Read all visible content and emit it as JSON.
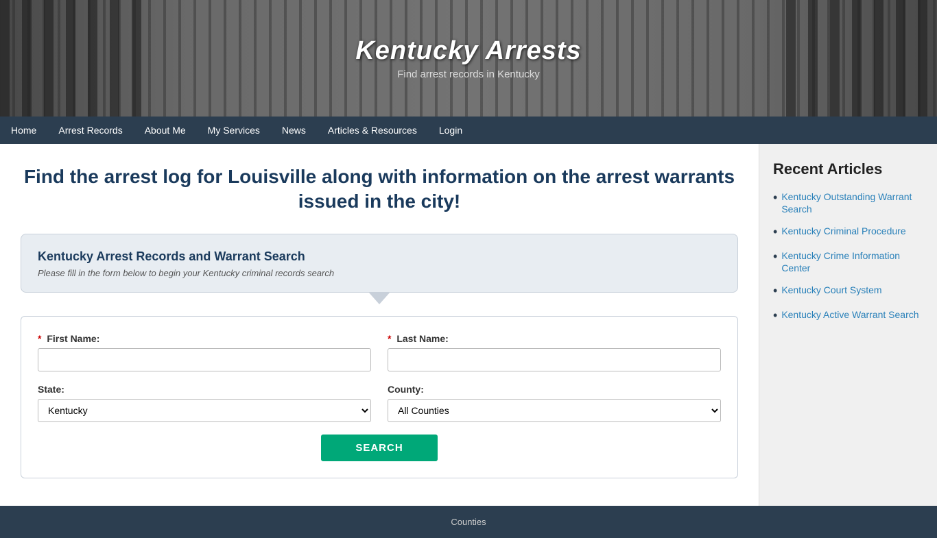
{
  "header": {
    "title": "Kentucky Arrests",
    "subtitle": "Find arrest records in Kentucky"
  },
  "nav": {
    "items": [
      {
        "label": "Home",
        "active": false
      },
      {
        "label": "Arrest Records",
        "active": false
      },
      {
        "label": "About Me",
        "active": false
      },
      {
        "label": "My Services",
        "active": false
      },
      {
        "label": "News",
        "active": false
      },
      {
        "label": "Articles & Resources",
        "active": false
      },
      {
        "label": "Login",
        "active": false
      }
    ]
  },
  "main": {
    "heading": "Find the arrest log for Louisville along with information on the arrest warrants issued in the city!",
    "search_box": {
      "title": "Kentucky Arrest Records and Warrant Search",
      "subtitle": "Please fill in the form below to begin your Kentucky criminal records search"
    },
    "form": {
      "first_name_label": "First Name:",
      "last_name_label": "Last Name:",
      "state_label": "State:",
      "county_label": "County:",
      "state_default": "Kentucky",
      "county_default": "All Counties",
      "search_button": "SEARCH",
      "state_options": [
        "Kentucky"
      ],
      "county_options": [
        "All Counties"
      ]
    }
  },
  "sidebar": {
    "title": "Recent Articles",
    "articles": [
      {
        "label": "Kentucky Outstanding Warrant Search"
      },
      {
        "label": "Kentucky Criminal Procedure"
      },
      {
        "label": "Kentucky Crime Information Center"
      },
      {
        "label": "Kentucky Court System"
      },
      {
        "label": "Kentucky Active Warrant Search"
      }
    ]
  },
  "footer": {
    "counties_label": "Counties"
  }
}
